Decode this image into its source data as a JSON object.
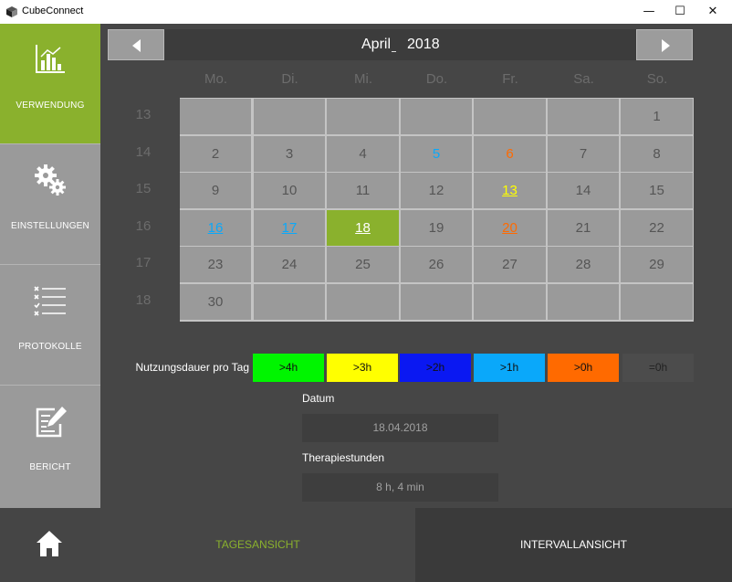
{
  "window": {
    "title": "CubeConnect",
    "controls": {
      "minimize": "—",
      "maximize": "☐",
      "close": "✕"
    }
  },
  "sidebar": {
    "items": [
      {
        "label": "VERWENDUNG",
        "icon": "bar-chart-icon",
        "active": true
      },
      {
        "label": "EINSTELLUNGEN",
        "icon": "gears-icon",
        "active": false
      },
      {
        "label": "PROTOKOLLE",
        "icon": "checklist-icon",
        "active": false
      },
      {
        "label": "BERICHT",
        "icon": "edit-report-icon",
        "active": false
      }
    ]
  },
  "calendar": {
    "month": "April",
    "year": "2018",
    "prev_icon": "triangle-left-icon",
    "next_icon": "triangle-right-icon",
    "weekdays": [
      "Mo.",
      "Di.",
      "Mi.",
      "Do.",
      "Fr.",
      "Sa.",
      "So."
    ],
    "weeks": [
      {
        "num": "13",
        "days": [
          "",
          "",
          "",
          "",
          "",
          "",
          "1"
        ]
      },
      {
        "num": "14",
        "days": [
          "2",
          "3",
          "4",
          "5",
          "6",
          "7",
          "8"
        ]
      },
      {
        "num": "15",
        "days": [
          "9",
          "10",
          "11",
          "12",
          "13",
          "14",
          "15"
        ]
      },
      {
        "num": "16",
        "days": [
          "16",
          "17",
          "18",
          "19",
          "20",
          "21",
          "22"
        ]
      },
      {
        "num": "17",
        "days": [
          "23",
          "24",
          "25",
          "26",
          "27",
          "28",
          "29"
        ]
      },
      {
        "num": "18",
        "days": [
          "30",
          "",
          "",
          "",
          "",
          "",
          ""
        ]
      }
    ],
    "day_usage": {
      "5": ">1h",
      "6": ">0h",
      "13": ">3h",
      "16": ">1h",
      "17": ">1h",
      "20": ">0h"
    },
    "underlined_days": [
      "13",
      "16",
      "17",
      "18",
      "20"
    ],
    "selected_day": "18"
  },
  "legend": {
    "label": "Nutzungsdauer pro Tag",
    "items": [
      {
        "text": ">4h",
        "color": "#00f500"
      },
      {
        "text": ">3h",
        "color": "#ffff00"
      },
      {
        "text": ">2h",
        "color": "#0a18f2"
      },
      {
        "text": ">1h",
        "color": "#0aa8fa"
      },
      {
        "text": ">0h",
        "color": "#ff6a00"
      },
      {
        "text": "=0h",
        "color": "#4c4c4c"
      }
    ]
  },
  "details": {
    "date_label": "Datum",
    "date_value": "18.04.2018",
    "hours_label": "Therapiestunden",
    "hours_value": "8 h, 4 min"
  },
  "bottom": {
    "home_icon": "home-icon",
    "tab_day": "TAGESANSICHT",
    "tab_interval": "INTERVALLANSICHT"
  },
  "colors": {
    "accent": "#8ab12d",
    "sidebar": "#9a9a9a",
    "background": "#464646",
    "cell": "#9a9a9a",
    "day_text": "#555555",
    "muted_text": "#6c6c6c",
    "field_bg": "#3e3e3e"
  }
}
